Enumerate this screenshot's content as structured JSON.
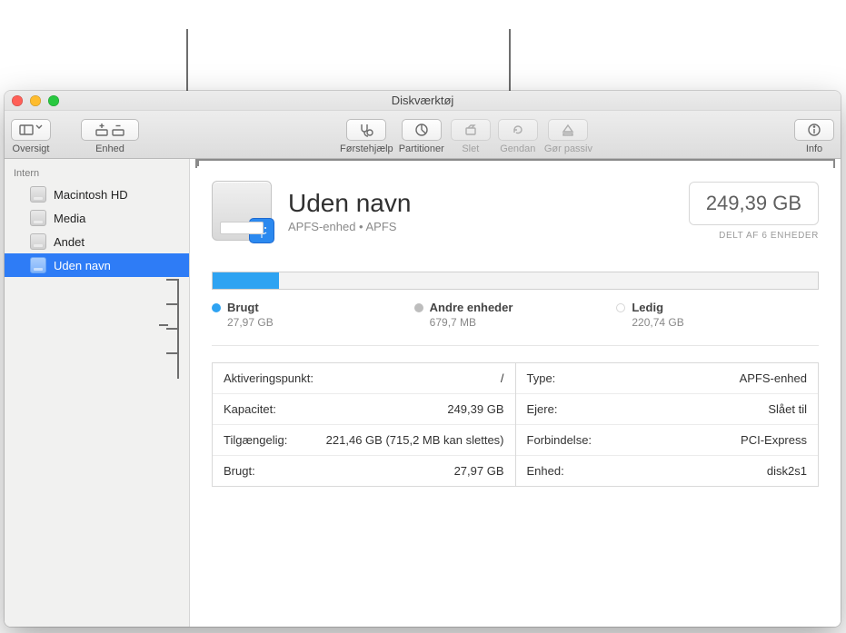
{
  "app": {
    "title": "Diskværktøj"
  },
  "toolbar": {
    "view_label": "Oversigt",
    "device_label": "Enhed",
    "firstaid_label": "Førstehjælp",
    "partition_label": "Partitioner",
    "erase_label": "Slet",
    "restore_label": "Gendan",
    "unmount_label": "Gør passiv",
    "info_label": "Info"
  },
  "sidebar": {
    "section": "Intern",
    "items": [
      {
        "label": "Macintosh HD"
      },
      {
        "label": "Media"
      },
      {
        "label": "Andet"
      },
      {
        "label": "Uden navn"
      }
    ]
  },
  "volume": {
    "name": "Uden navn",
    "subtitle": "APFS-enhed • APFS",
    "capacity": "249,39 GB",
    "shared": "DELT AF 6 ENHEDER"
  },
  "usage": {
    "fill_percent": 11,
    "used_label": "Brugt",
    "used_value": "27,97 GB",
    "other_label": "Andre enheder",
    "other_value": "679,7 MB",
    "free_label": "Ledig",
    "free_value": "220,74 GB"
  },
  "info_left": [
    {
      "k": "Aktiveringspunkt:",
      "v": "/"
    },
    {
      "k": "Kapacitet:",
      "v": "249,39 GB"
    },
    {
      "k": "Tilgængelig:",
      "v": "221,46 GB (715,2 MB kan slettes)"
    },
    {
      "k": "Brugt:",
      "v": "27,97 GB"
    }
  ],
  "info_right": [
    {
      "k": "Type:",
      "v": "APFS-enhed"
    },
    {
      "k": "Ejere:",
      "v": "Slået til"
    },
    {
      "k": "Forbindelse:",
      "v": "PCI-Express"
    },
    {
      "k": "Enhed:",
      "v": "disk2s1"
    }
  ]
}
